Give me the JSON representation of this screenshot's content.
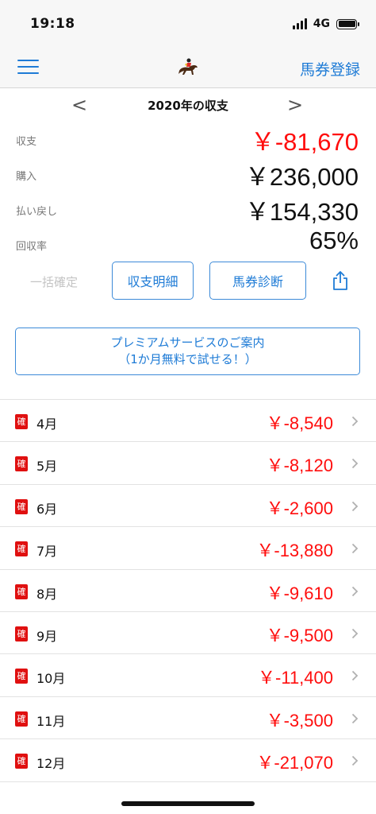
{
  "status_bar": {
    "time": "19:18",
    "network": "4G",
    "icons": [
      "signal-icon",
      "battery-icon"
    ]
  },
  "nav": {
    "menu_icon": "hamburger-menu-icon",
    "logo_icon": "jockey-horse-icon",
    "register_label": "馬券登録"
  },
  "year_selector": {
    "prev": "<",
    "title": "2020年の収支",
    "next": ">"
  },
  "summary": {
    "balance": {
      "label": "収支",
      "value": "￥-81,670"
    },
    "purchase": {
      "label": "購入",
      "value": "￥236,000"
    },
    "refund": {
      "label": "払い戻し",
      "value": "￥154,330"
    },
    "recovery": {
      "label": "回収率",
      "value": "65%"
    }
  },
  "actions": {
    "bulk_confirm": "一括確定",
    "detail": "収支明細",
    "diagnosis": "馬券診断",
    "share_icon": "share-icon"
  },
  "premium": {
    "line1": "プレミアムサービスのご案内",
    "line2": "（1か月無料で試せる！）"
  },
  "months": [
    {
      "badge": "確",
      "month": "4月",
      "value": "￥-8,540"
    },
    {
      "badge": "確",
      "month": "5月",
      "value": "￥-8,120"
    },
    {
      "badge": "確",
      "month": "6月",
      "value": "￥-2,600"
    },
    {
      "badge": "確",
      "month": "7月",
      "value": "￥-13,880"
    },
    {
      "badge": "確",
      "month": "8月",
      "value": "￥-9,610"
    },
    {
      "badge": "確",
      "month": "9月",
      "value": "￥-9,500"
    },
    {
      "badge": "確",
      "month": "10月",
      "value": "￥-11,400"
    },
    {
      "badge": "確",
      "month": "11月",
      "value": "￥-3,500"
    },
    {
      "badge": "確",
      "month": "12月",
      "value": "￥-21,070"
    }
  ],
  "colors": {
    "accent": "#1e7bd6",
    "negative": "#ff0d0d",
    "badge": "#e01010"
  }
}
